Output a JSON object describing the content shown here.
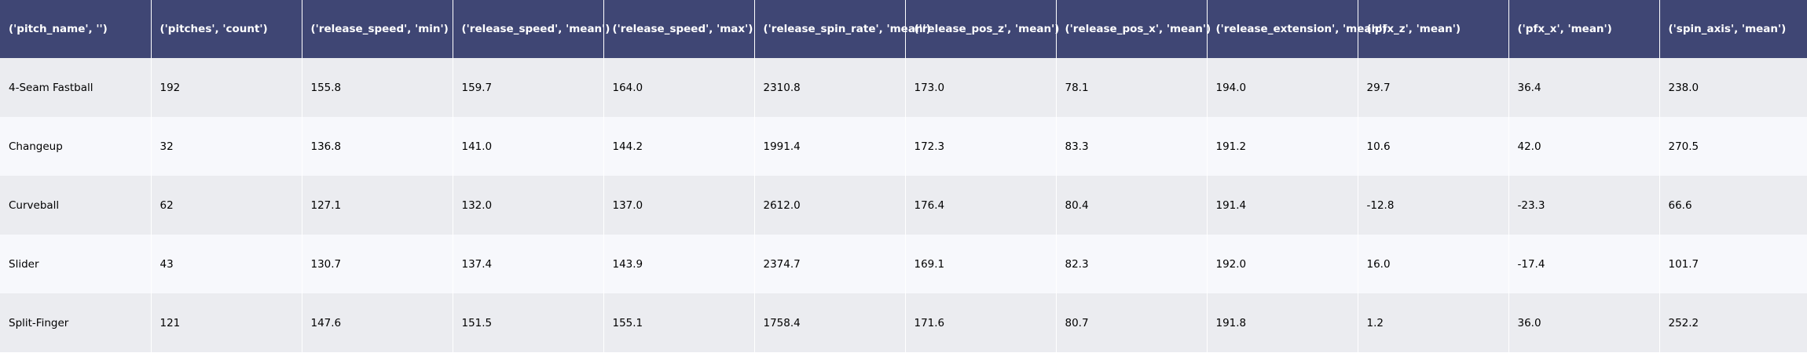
{
  "chart_data": {
    "type": "table",
    "colors": {
      "header_fill": "#3f4674",
      "header_text": "#ffffff",
      "row_fill_odd": "#ebecf0",
      "row_fill_even": "#f7f8fc",
      "cell_text": "#000000"
    },
    "columns": [
      "('pitch_name', '')",
      "('pitches', 'count')",
      "('release_speed', 'min')",
      "('release_speed', 'mean')",
      "('release_speed', 'max')",
      "('release_spin_rate', 'mean')",
      "('release_pos_z', 'mean')",
      "('release_pos_x', 'mean')",
      "('release_extension', 'mean')",
      "('pfx_z', 'mean')",
      "('pfx_x', 'mean')",
      "('spin_axis', 'mean')"
    ],
    "rows": [
      [
        "4-Seam Fastball",
        "192",
        "155.8",
        "159.7",
        "164.0",
        "2310.8",
        "173.0",
        "78.1",
        "194.0",
        "29.7",
        "36.4",
        "238.0"
      ],
      [
        "Changeup",
        "32",
        "136.8",
        "141.0",
        "144.2",
        "1991.4",
        "172.3",
        "83.3",
        "191.2",
        "10.6",
        "42.0",
        "270.5"
      ],
      [
        "Curveball",
        "62",
        "127.1",
        "132.0",
        "137.0",
        "2612.0",
        "176.4",
        "80.4",
        "191.4",
        "-12.8",
        "-23.3",
        "66.6"
      ],
      [
        "Slider",
        "43",
        "130.7",
        "137.4",
        "143.9",
        "2374.7",
        "169.1",
        "82.3",
        "192.0",
        "16.0",
        "-17.4",
        "101.7"
      ],
      [
        "Split-Finger",
        "121",
        "147.6",
        "151.5",
        "155.1",
        "1758.4",
        "171.6",
        "80.7",
        "191.8",
        "1.2",
        "36.0",
        "252.2"
      ]
    ]
  }
}
